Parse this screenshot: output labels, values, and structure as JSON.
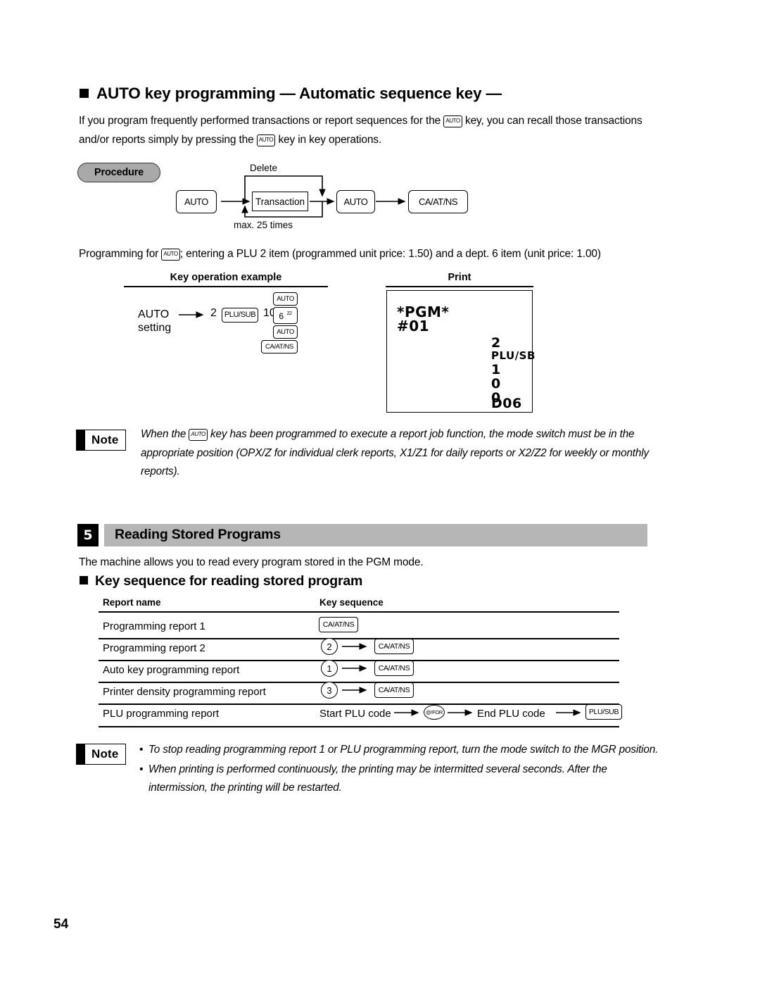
{
  "page": {
    "number": "54"
  },
  "section_auto": {
    "heading": "AUTO key programming — Automatic sequence key —",
    "heading_part1": "AUTO key programming",
    "heading_dash": "—",
    "heading_part2": "Automatic sequence key",
    "heading_dash2": "—",
    "intro_a": "If you program frequently performed transactions or report sequences for the",
    "intro_b": "key, you can recall those transactions and/or reports simply by pressing the",
    "intro_c": "key in key operations.",
    "procedure_label": "Procedure",
    "diagram": {
      "delete_label": "Delete",
      "max_label": "max. 25 times",
      "key_auto_1": "AUTO",
      "transaction": "Transaction",
      "key_auto_2": "AUTO",
      "key_caatns": "CA/AT/NS"
    },
    "progfor_a": "Programming for",
    "progfor_b": "; entering a PLU 2 item (programmed unit price: 1.50) and a dept. 6 item (unit price: 1.00)",
    "example": {
      "col1_title": "Key operation example",
      "col2_title": "Print",
      "auto_line1": "AUTO",
      "auto_line2": "setting",
      "qty": "2",
      "key_plusub": "PLU/SUB",
      "amount": "100",
      "key_dept_main": "6",
      "key_dept_sup": "22",
      "key_auto_top": "AUTO",
      "key_auto_bottom": "AUTO",
      "key_caatns": "CA/AT/NS"
    },
    "receipt": {
      "line_pgm": "*PGM*",
      "line_no": "#01",
      "r_qty": "2",
      "r_plusb": "PLU/SB",
      "r_1": "1",
      "r_0a": "0",
      "r_0b": "0",
      "r_d06": "D06"
    },
    "note": {
      "label": "Note",
      "text_a": "When the",
      "key": "AUTO",
      "text_b": "key has been programmed to execute a report job function, the mode switch must be in the appropriate position (OPX/Z for individual clerk reports, X1/Z1 for daily reports or X2/Z2 for weekly or monthly reports)."
    }
  },
  "section_reading": {
    "number": "5",
    "title": "Reading Stored Programs",
    "intro": "The machine allows you to read every program stored in the PGM mode.",
    "subheading": "Key sequence for reading stored program",
    "table": {
      "headers": [
        "Report name",
        "Key sequence"
      ],
      "rows": [
        {
          "name": "Programming report 1",
          "seq_type": "key",
          "key": "CA/AT/NS"
        },
        {
          "name": "Programming report 2",
          "seq_type": "num-arrow-key",
          "num": "2",
          "key": "CA/AT/NS"
        },
        {
          "name": "Auto key programming report",
          "seq_type": "num-arrow-key",
          "num": "1",
          "key": "CA/AT/NS"
        },
        {
          "name": "Printer density programming report",
          "seq_type": "num-arrow-key",
          "num": "3",
          "key": "CA/AT/NS"
        },
        {
          "name": "PLU programming report",
          "seq_type": "plu",
          "start_label": "Start PLU code",
          "oval_key": "@/FOR",
          "end_label": "End PLU code",
          "key": "PLU/SUB"
        }
      ]
    },
    "note": {
      "label": "Note",
      "bullet1": "To stop reading programming report 1 or PLU programming report, turn the mode switch to the MGR position.",
      "bullet2": "When printing is performed continuously, the printing may be intermitted several seconds.  After the intermission, the printing will be restarted."
    }
  },
  "colors": {
    "gray_bar": "#b6b6b6",
    "pill_gray": "#a9a9a9",
    "ink": "#000000",
    "paper": "#ffffff"
  }
}
